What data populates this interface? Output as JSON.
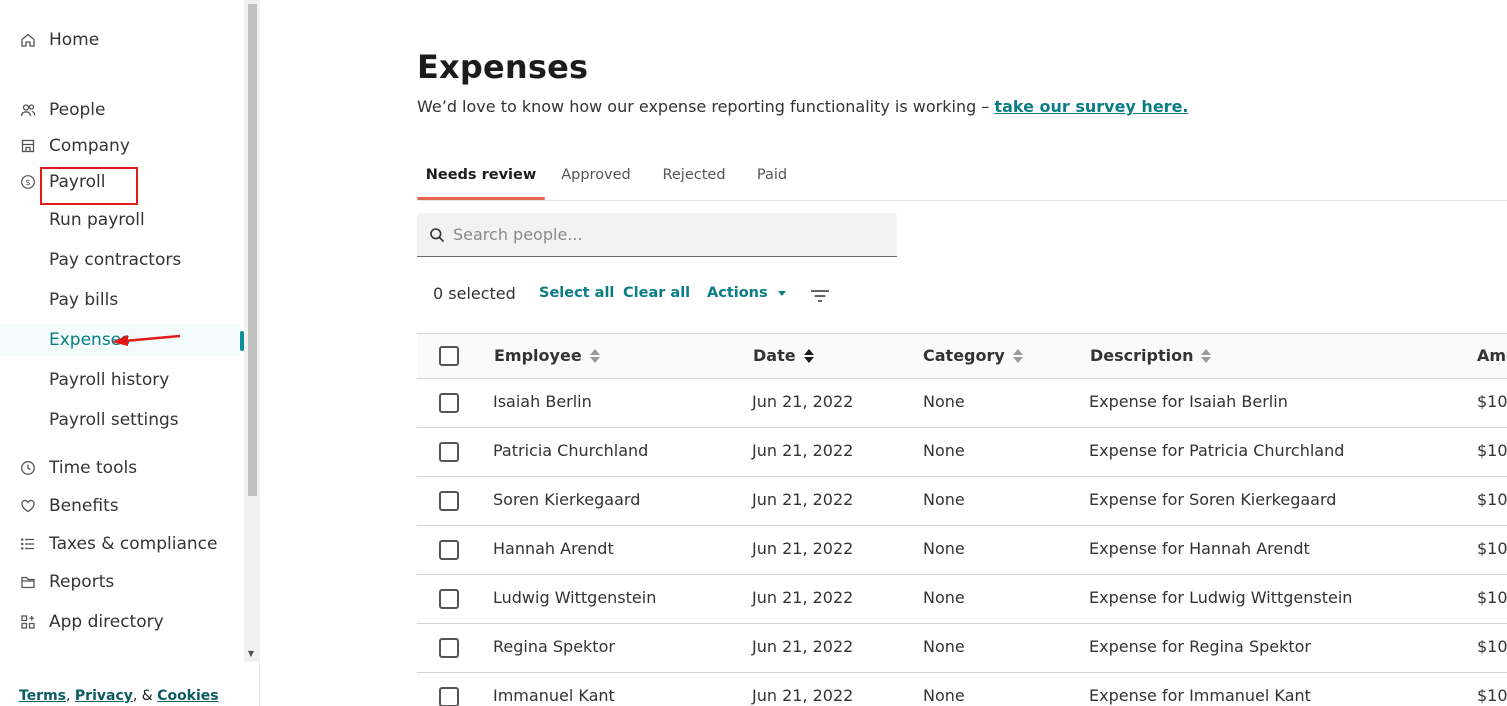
{
  "sidebar": {
    "items": [
      {
        "label": "Home",
        "icon": "home-icon"
      },
      {
        "label": "People",
        "icon": "people-icon"
      },
      {
        "label": "Company",
        "icon": "building-icon"
      },
      {
        "label": "Payroll",
        "icon": "dollar-icon"
      },
      {
        "label": "Run payroll"
      },
      {
        "label": "Pay contractors"
      },
      {
        "label": "Pay bills"
      },
      {
        "label": "Expenses"
      },
      {
        "label": "Payroll history"
      },
      {
        "label": "Payroll settings"
      },
      {
        "label": "Time tools",
        "icon": "clock-icon"
      },
      {
        "label": "Benefits",
        "icon": "heart-icon"
      },
      {
        "label": "Taxes & compliance",
        "icon": "list-icon"
      },
      {
        "label": "Reports",
        "icon": "folder-icon"
      },
      {
        "label": "App directory",
        "icon": "apps-icon"
      }
    ],
    "footer": {
      "terms": "Terms",
      "privacy": "Privacy",
      "cookies": "Cookies",
      "sep1": ", ",
      "sep2": ", & "
    }
  },
  "main": {
    "title": "Expenses",
    "survey_text": "We’d love to know how our expense reporting functionality is working – ",
    "survey_link": "take our survey here.",
    "tabs": [
      {
        "label": "Needs review"
      },
      {
        "label": "Approved"
      },
      {
        "label": "Rejected"
      },
      {
        "label": "Paid"
      }
    ],
    "search": {
      "placeholder": "Search people..."
    },
    "toolbar": {
      "selected": "0 selected",
      "select_all": "Select all",
      "clear_all": "Clear all",
      "actions": "Actions"
    },
    "table": {
      "columns": [
        "Employee",
        "Date",
        "Category",
        "Description",
        "Amo"
      ],
      "rows": [
        {
          "employee": "Isaiah Berlin",
          "date": "Jun 21, 2022",
          "category": "None",
          "description": "Expense for Isaiah Berlin",
          "amount": "$10"
        },
        {
          "employee": "Patricia Churchland",
          "date": "Jun 21, 2022",
          "category": "None",
          "description": "Expense for Patricia Churchland",
          "amount": "$10"
        },
        {
          "employee": "Soren Kierkegaard",
          "date": "Jun 21, 2022",
          "category": "None",
          "description": "Expense for Soren Kierkegaard",
          "amount": "$10"
        },
        {
          "employee": "Hannah Arendt",
          "date": "Jun 21, 2022",
          "category": "None",
          "description": "Expense for Hannah Arendt",
          "amount": "$10"
        },
        {
          "employee": "Ludwig Wittgenstein",
          "date": "Jun 21, 2022",
          "category": "None",
          "description": "Expense for Ludwig Wittgenstein",
          "amount": "$10"
        },
        {
          "employee": "Regina Spektor",
          "date": "Jun 21, 2022",
          "category": "None",
          "description": "Expense for Regina Spektor",
          "amount": "$10"
        },
        {
          "employee": "Immanuel Kant",
          "date": "Jun 21, 2022",
          "category": "None",
          "description": "Expense for Immanuel Kant",
          "amount": "$10"
        }
      ]
    }
  },
  "colors": {
    "accent": "#0a7d84",
    "tab_underline": "#e2664f",
    "annotation": "#e01919"
  }
}
